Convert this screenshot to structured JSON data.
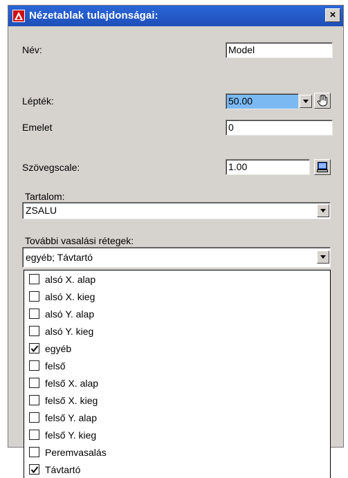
{
  "window": {
    "title": "Nézetablak tulajdonságai:",
    "close_glyph": "×"
  },
  "fields": {
    "nev": {
      "label": "Név:",
      "value": "Model"
    },
    "leptek": {
      "label": "Lépték:",
      "value": "50.00"
    },
    "emelet": {
      "label": "Emelet",
      "value": "0"
    },
    "szovegscale": {
      "label": "Szövegscale:",
      "value": "1.00"
    }
  },
  "tartalom": {
    "label": "Tartalom:",
    "value": "ZSALU"
  },
  "vasalasi": {
    "label": "További vasalási rétegek:",
    "value": "egyéb; Távtartó"
  },
  "list_items": [
    {
      "label": "alsó X. alap",
      "checked": false
    },
    {
      "label": "alsó X. kieg",
      "checked": false
    },
    {
      "label": "alsó Y. alap",
      "checked": false
    },
    {
      "label": "alsó Y. kieg",
      "checked": false
    },
    {
      "label": "egyéb",
      "checked": true
    },
    {
      "label": "felső",
      "checked": false
    },
    {
      "label": "felső X. alap",
      "checked": false
    },
    {
      "label": "felső X. kieg",
      "checked": false
    },
    {
      "label": "felső Y. alap",
      "checked": false
    },
    {
      "label": "felső Y. kieg",
      "checked": false
    },
    {
      "label": "Peremvasalás",
      "checked": false
    },
    {
      "label": "Távtartó",
      "checked": true
    }
  ],
  "icons": {
    "logo": "autocad-logo-icon",
    "hand": "hand-pointer-icon",
    "monitor": "monitor-icon"
  },
  "colors": {
    "title_bar": "#1f4fb8",
    "highlight": "#7ab9f2",
    "dialog_bg": "#d6d3ce"
  }
}
